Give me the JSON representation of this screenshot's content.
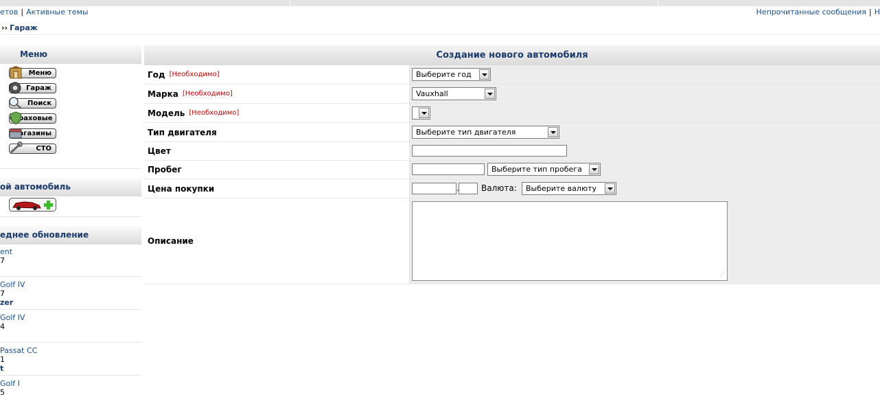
{
  "top": {
    "left_links": [
      "етов",
      "Активные темы"
    ],
    "right_links": [
      "Непрочитанные сообщения",
      "Н"
    ]
  },
  "breadcrumb": {
    "arrow": "››",
    "label": "Гараж"
  },
  "sidebar": {
    "menu_title": "Меню",
    "menu_items": [
      {
        "label": "Меню",
        "icon": "house-icon"
      },
      {
        "label": "Гараж",
        "icon": "wheel-icon"
      },
      {
        "label": "Поиск",
        "icon": "magnifier-icon"
      },
      {
        "label": "Страховые",
        "icon": "shield-icon"
      },
      {
        "label": "Магазины",
        "icon": "shop-icon"
      },
      {
        "label": "СТО",
        "icon": "wrench-icon"
      }
    ],
    "my_car_title": "Мой автомобиль",
    "my_car_title_visible": "ой автомобиль",
    "add_car_icon": "add-car-icon",
    "updates_title": "еднее обновление",
    "updates": [
      {
        "car": "ent",
        "year": "7",
        "user": ""
      },
      {
        "car": "Golf IV",
        "year": "7",
        "user": "zer"
      },
      {
        "car": "Golf IV",
        "year": "4",
        "user": ""
      },
      {
        "car": "Passat CC",
        "year": "1",
        "user": "t"
      },
      {
        "car": "Golf I",
        "year": "5",
        "user": ""
      }
    ]
  },
  "form": {
    "title": "Создание нового автомобиля",
    "required_text": "[Необходимо]",
    "year_label": "Год",
    "year_value": "Выберите год",
    "make_label": "Марка",
    "make_value": "Vauxhall",
    "model_label": "Модель",
    "model_value": "",
    "engine_label": "Тип двигателя",
    "engine_value": "Выберите тип двигателя",
    "color_label": "Цвет",
    "color_value": "",
    "mileage_label": "Пробег",
    "mileage_value": "",
    "mileage_type_value": "Выберите тип пробега",
    "price_label": "Цена покупки",
    "price_main": "",
    "price_decimal_sep": ".",
    "price_cents": "",
    "currency_label": "Валюта:",
    "currency_value": "Выберите валюту",
    "description_label": "Описание",
    "description_value": ""
  }
}
